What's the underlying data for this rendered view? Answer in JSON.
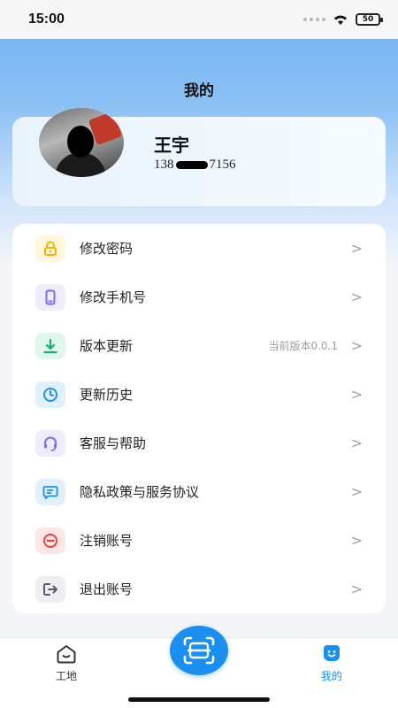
{
  "status_bar": {
    "time": "15:00",
    "battery": "50"
  },
  "page_title": "我的",
  "profile": {
    "name": "王宇",
    "phone_prefix": "138",
    "phone_suffix": "7156"
  },
  "menu": [
    {
      "key": "change-password",
      "label": "修改密码",
      "icon": "lock-icon",
      "color": "#f3b400",
      "bg": "#fff6dc",
      "value": ""
    },
    {
      "key": "change-phone",
      "label": "修改手机号",
      "icon": "phone-icon",
      "color": "#7b6cf0",
      "bg": "#eeecfd",
      "value": ""
    },
    {
      "key": "version-update",
      "label": "版本更新",
      "icon": "download-icon",
      "color": "#16b06a",
      "bg": "#dff6ea",
      "value": "当前版本0.0.1"
    },
    {
      "key": "update-history",
      "label": "更新历史",
      "icon": "clock-icon",
      "color": "#1b8ff0",
      "bg": "#e1f0fd",
      "value": ""
    },
    {
      "key": "customer-service",
      "label": "客服与帮助",
      "icon": "headset-icon",
      "color": "#7b6cf0",
      "bg": "#eeecfd",
      "value": ""
    },
    {
      "key": "privacy-policy",
      "label": "隐私政策与服务协议",
      "icon": "chat-icon",
      "color": "#1b8ff0",
      "bg": "#e1f0fd",
      "value": ""
    },
    {
      "key": "delete-account",
      "label": "注销账号",
      "icon": "minus-circle-icon",
      "color": "#e2453c",
      "bg": "#fde6e4",
      "value": ""
    },
    {
      "key": "logout",
      "label": "退出账号",
      "icon": "logout-icon",
      "color": "#555b66",
      "bg": "#eceef1",
      "value": ""
    }
  ],
  "chevron": ">",
  "tab_bar": {
    "tabs": [
      {
        "label": "工地",
        "icon": "home-icon",
        "active": false
      },
      {
        "label": "我的",
        "icon": "smile-icon",
        "active": true
      }
    ],
    "scan_icon": "scan-icon",
    "active_color": "#1b8ff0",
    "inactive_color": "#333333"
  }
}
